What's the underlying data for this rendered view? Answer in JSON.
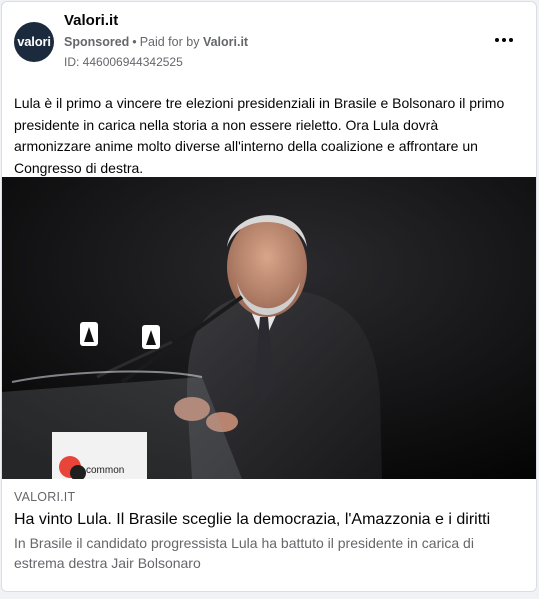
{
  "post": {
    "page_name": "Valori.it",
    "avatar_text": "valori",
    "sponsored_label": "Sponsored",
    "separator": "•",
    "paid_for_prefix": "Paid for by",
    "paid_for_by": "Valori.it",
    "ad_id": "ID: 446006944342525",
    "more_icon": "more-horizontal-icon",
    "body_text": "Lula è il primo a vincere tre elezioni presidenziali in Brasile e Bolsonaro il primo presidente in carica nella storia a non essere rieletto. Ora Lula dovrà armonizzare anime molto diverse all'interno della coalizione e affrontare un Congresso di destra."
  },
  "image": {
    "podium_logo_text": "common"
  },
  "link_preview": {
    "domain": "VALORI.IT",
    "headline": "Ha vinto Lula. Il Brasile sceglie la democrazia, l'Amazzonia e i diritti",
    "description": "In Brasile il candidato progressista Lula ha battuto il presidente in carica di estrema destra Jair Bolsonaro"
  },
  "colors": {
    "avatar_bg": "#1b2a3c",
    "text_primary": "#050505",
    "text_secondary": "#65676b",
    "border": "#dadde1",
    "background": "#f0f2f5"
  }
}
